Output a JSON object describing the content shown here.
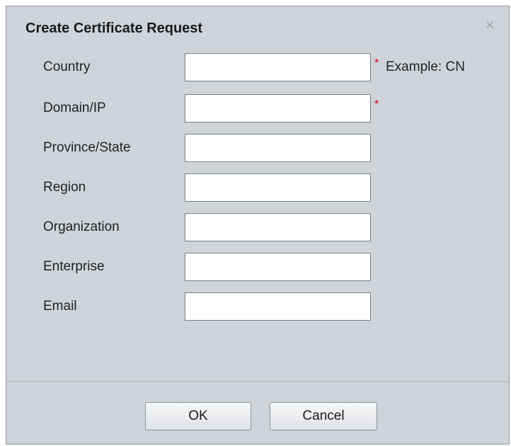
{
  "dialog": {
    "title": "Create Certificate Request",
    "close_glyph": "×"
  },
  "fields": [
    {
      "label": "Country",
      "value": "",
      "required": true,
      "hint": "Example: CN"
    },
    {
      "label": "Domain/IP",
      "value": "",
      "required": true,
      "hint": ""
    },
    {
      "label": "Province/State",
      "value": "",
      "required": false,
      "hint": ""
    },
    {
      "label": "Region",
      "value": "",
      "required": false,
      "hint": ""
    },
    {
      "label": "Organization",
      "value": "",
      "required": false,
      "hint": ""
    },
    {
      "label": "Enterprise",
      "value": "",
      "required": false,
      "hint": ""
    },
    {
      "label": "Email",
      "value": "",
      "required": false,
      "hint": ""
    }
  ],
  "required_marker": "*",
  "buttons": {
    "ok_label": "OK",
    "cancel_label": "Cancel"
  },
  "colors": {
    "dialog_bg": "#cfd4db",
    "required": "#d0021b"
  },
  "icons": {
    "close": "close-icon"
  }
}
